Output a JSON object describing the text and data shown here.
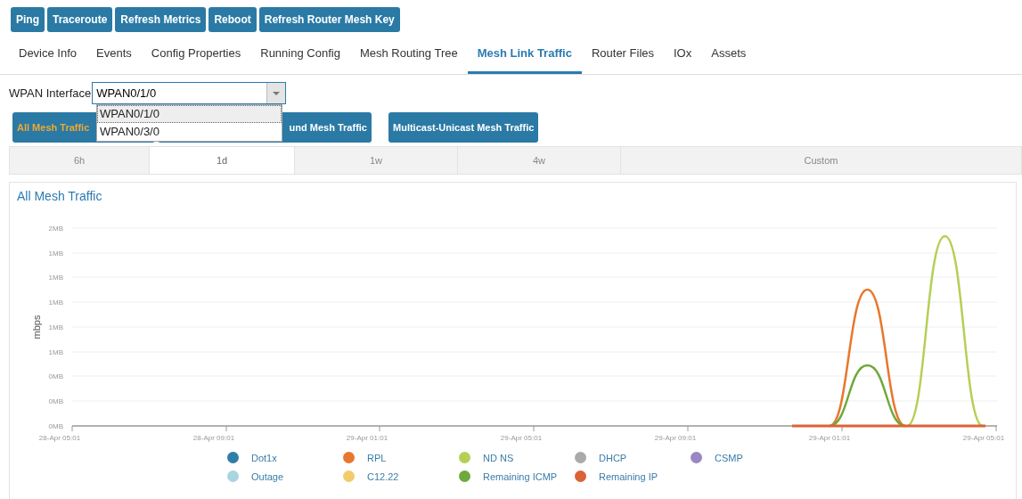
{
  "actions": [
    {
      "label": "Ping"
    },
    {
      "label": "Traceroute"
    },
    {
      "label": "Refresh Metrics"
    },
    {
      "label": "Reboot"
    },
    {
      "label": "Refresh Router Mesh Key"
    }
  ],
  "tabs": [
    {
      "label": "Device Info",
      "selected": false
    },
    {
      "label": "Events",
      "selected": false
    },
    {
      "label": "Config Properties",
      "selected": false
    },
    {
      "label": "Running Config",
      "selected": false
    },
    {
      "label": "Mesh Routing Tree",
      "selected": false
    },
    {
      "label": "Mesh Link Traffic",
      "selected": true
    },
    {
      "label": "Router Files",
      "selected": false
    },
    {
      "label": "IOx",
      "selected": false
    },
    {
      "label": "Assets",
      "selected": false
    }
  ],
  "wpan": {
    "label": "WPAN Interface",
    "value": "WPAN0/1/0",
    "expanded": true,
    "options": [
      {
        "label": "WPAN0/1/0",
        "selected": true
      },
      {
        "label": "WPAN0/3/0",
        "selected": false
      }
    ]
  },
  "traffic_buttons": [
    {
      "label": "All Mesh Traffic",
      "selected": true
    },
    {
      "label": "und Mesh Traffic",
      "selected": false
    },
    {
      "label": "Multicast-Unicast Mesh Traffic",
      "selected": false
    }
  ],
  "ranges": [
    {
      "label": "6h",
      "selected": false
    },
    {
      "label": "1d",
      "selected": true
    },
    {
      "label": "1w",
      "selected": false
    },
    {
      "label": "4w",
      "selected": false
    },
    {
      "label": "Custom",
      "selected": false
    }
  ],
  "chart": {
    "title": "All Mesh Traffic",
    "ylabel": "mbps",
    "ytick_labels": [
      "2MB",
      "1MB",
      "1MB",
      "1MB",
      "1MB",
      "1MB",
      "0MB",
      "0MB",
      "0MB"
    ],
    "xtick_labels": [
      "28-Apr 05:01",
      "28-Apr 09:01",
      "29-Apr 01:01",
      "29-Apr 05:01",
      "29-Apr 09:01",
      "29-Apr 01:01",
      "29-Apr 05:01"
    ],
    "legend": [
      {
        "label": "Dot1x",
        "color": "#2e7ea8"
      },
      {
        "label": "RPL",
        "color": "#e8772e"
      },
      {
        "label": "ND NS",
        "color": "#b5cf55"
      },
      {
        "label": "DHCP",
        "color": "#aaaaaa"
      },
      {
        "label": "CSMP",
        "color": "#9b86c4"
      },
      {
        "label": "Outage",
        "color": "#a8d5e0"
      },
      {
        "label": "C12.22",
        "color": "#f2cc6b"
      },
      {
        "label": "Remaining ICMP",
        "color": "#6fa83b"
      },
      {
        "label": "Remaining IP",
        "color": "#dc6237"
      }
    ]
  }
}
